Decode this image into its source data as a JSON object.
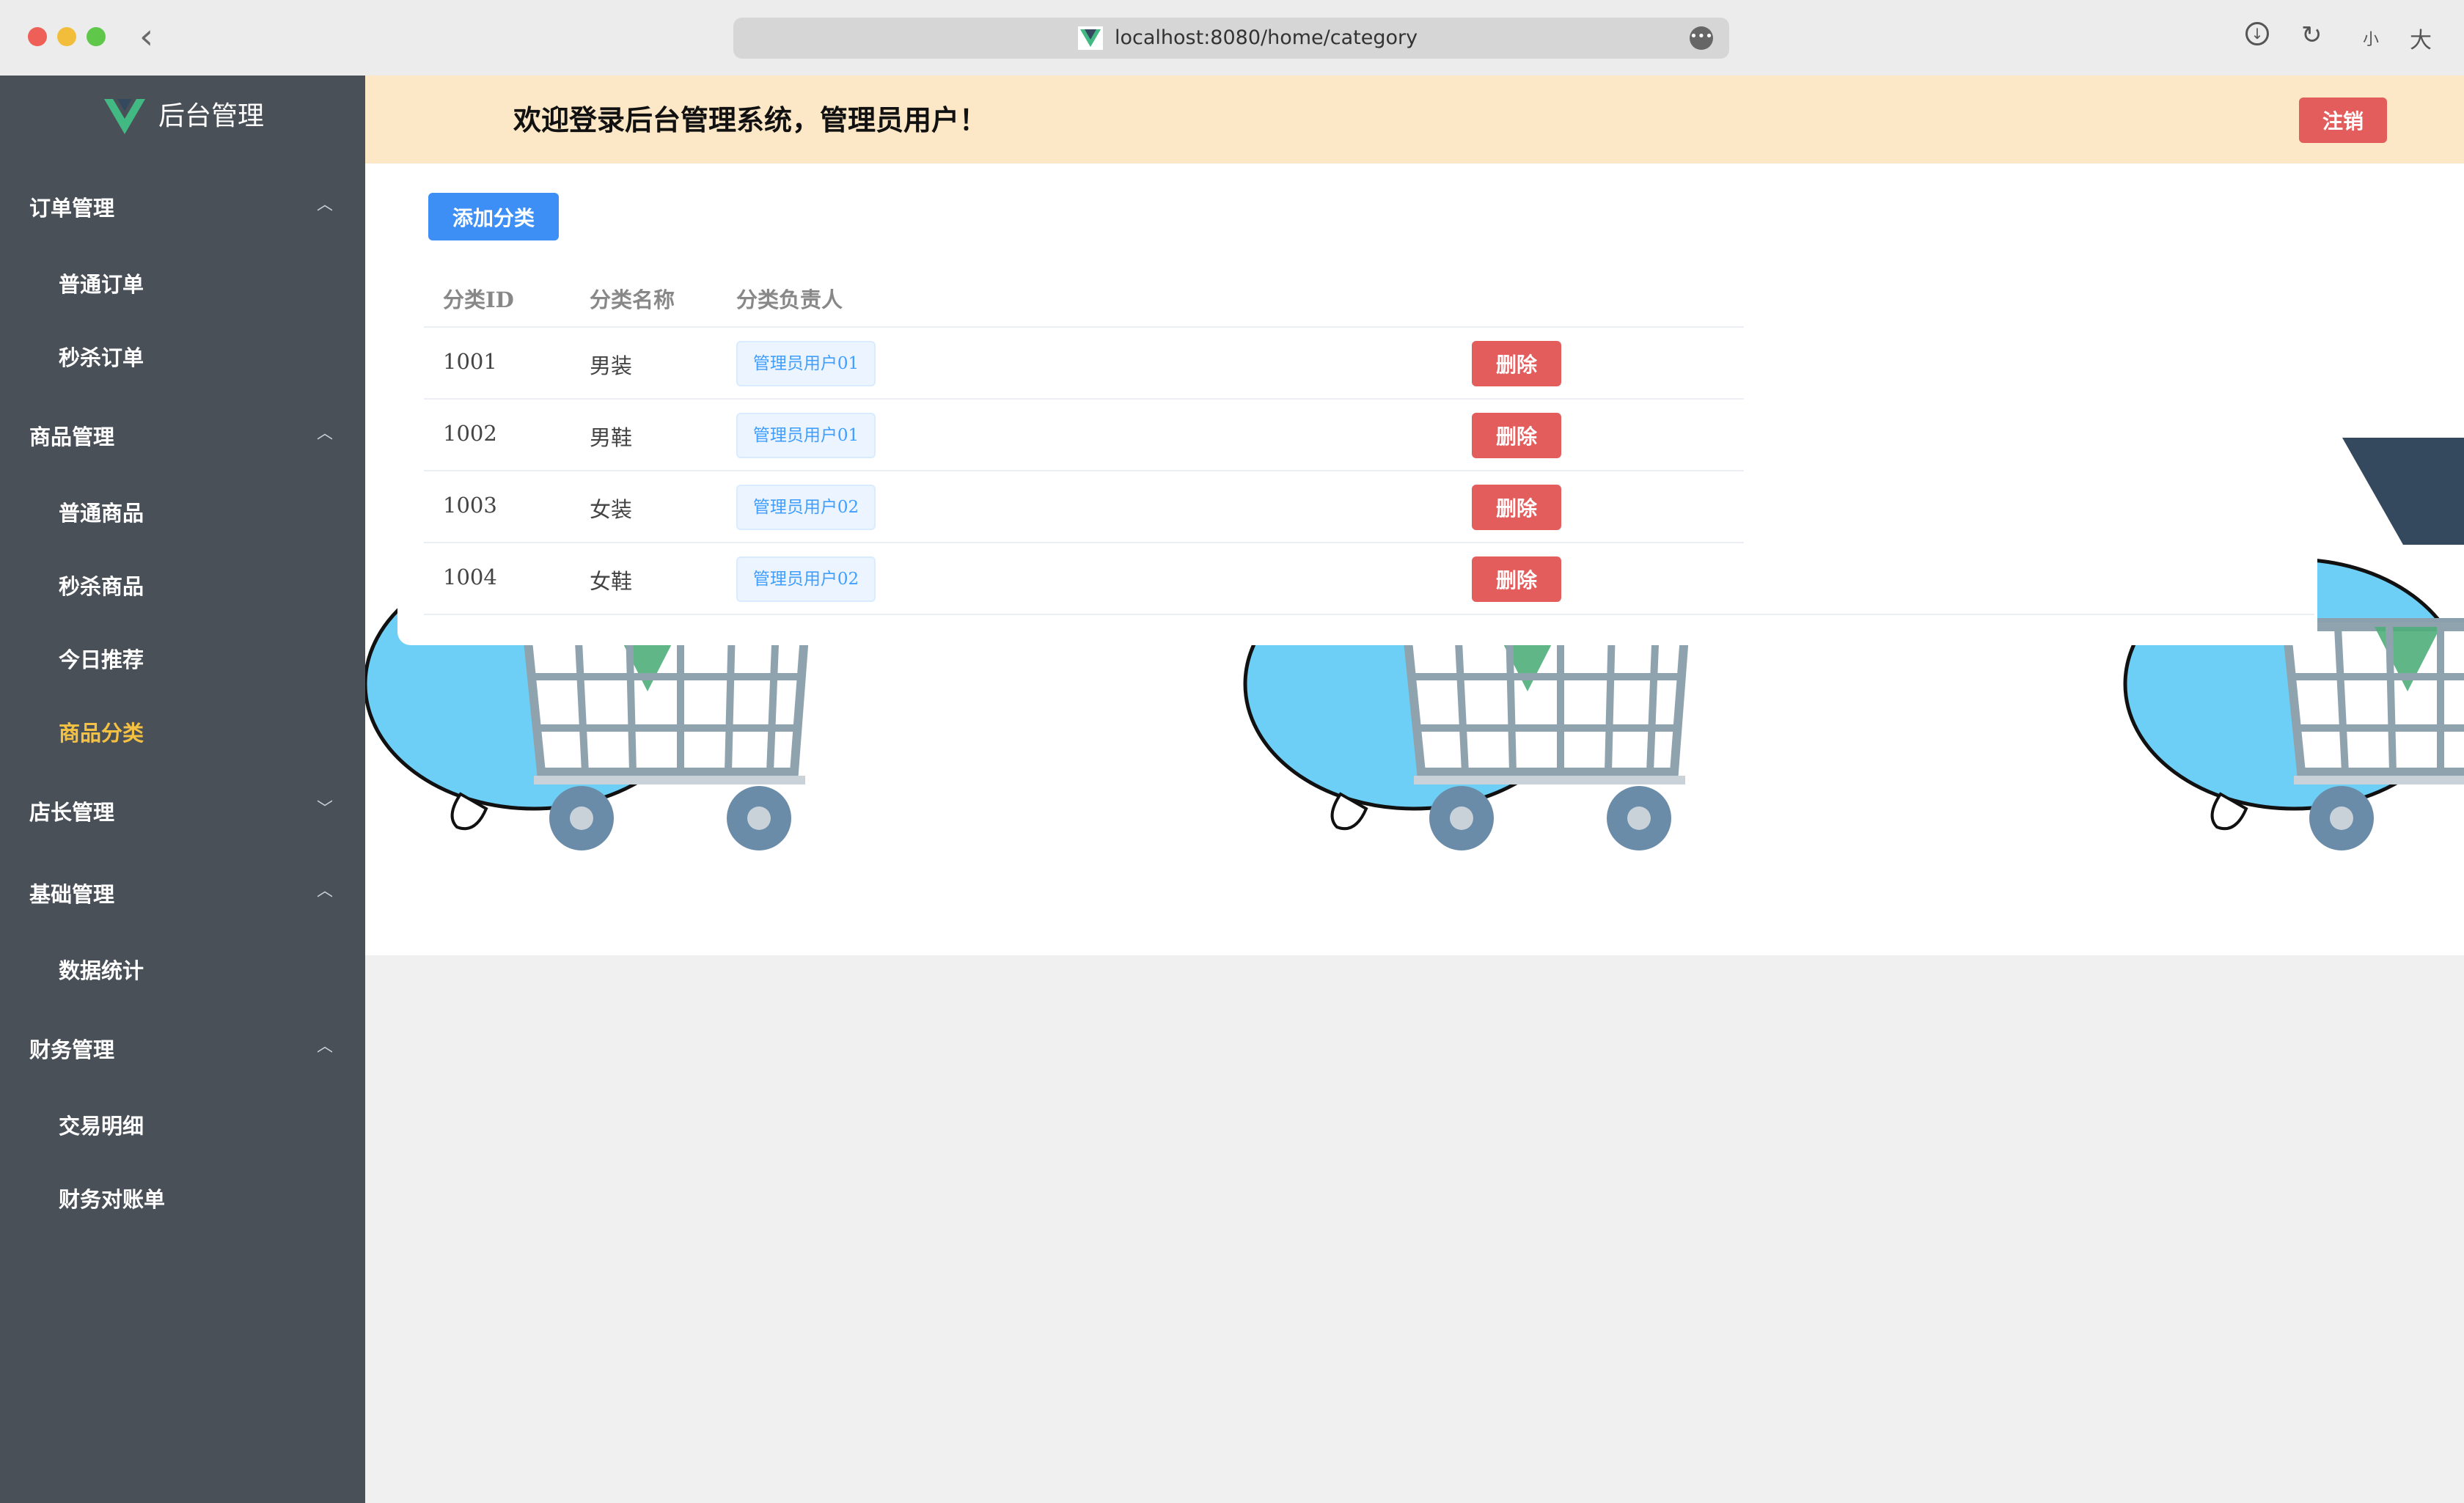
{
  "browser": {
    "url": "localhost:8080/home/category",
    "back_glyph": "‹",
    "more_glyph": "•••",
    "download_glyph": "↓",
    "reload_glyph": "↻",
    "text_small": "小",
    "text_large": "大"
  },
  "sidebar": {
    "app_title": "后台管理",
    "groups": [
      {
        "label": "订单管理",
        "expanded": true,
        "items": [
          "普通订单",
          "秒杀订单"
        ]
      },
      {
        "label": "商品管理",
        "expanded": true,
        "items": [
          "普通商品",
          "秒杀商品",
          "今日推荐",
          "商品分类"
        ]
      },
      {
        "label": "店长管理",
        "expanded": false,
        "items": []
      },
      {
        "label": "基础管理",
        "expanded": true,
        "items": [
          "数据统计"
        ]
      },
      {
        "label": "财务管理",
        "expanded": true,
        "items": [
          "交易明细",
          "财务对账单"
        ]
      }
    ],
    "active_item": "商品分类",
    "chevron_up": "︿",
    "chevron_down": "﹀"
  },
  "header": {
    "welcome": "欢迎登录后台管理系统，管理员用户！",
    "logout_label": "注销"
  },
  "toolbar": {
    "add_label": "添加分类"
  },
  "table": {
    "columns": [
      "分类ID",
      "分类名称",
      "分类负责人"
    ],
    "rows": [
      {
        "id": "1001",
        "name": "男装",
        "owner": "管理员用户01",
        "action": "删除"
      },
      {
        "id": "1002",
        "name": "男鞋",
        "owner": "管理员用户01",
        "action": "删除"
      },
      {
        "id": "1003",
        "name": "女装",
        "owner": "管理员用户02",
        "action": "删除"
      },
      {
        "id": "1004",
        "name": "女鞋",
        "owner": "管理员用户02",
        "action": "删除"
      }
    ]
  },
  "colors": {
    "sidebar_bg": "#4a5058",
    "active_menu": "#f5c142",
    "header_bg": "#fce7c6",
    "primary": "#3d8ff5",
    "danger": "#e45d5d",
    "vue_green": "#42b883",
    "vue_dark": "#35495e"
  }
}
